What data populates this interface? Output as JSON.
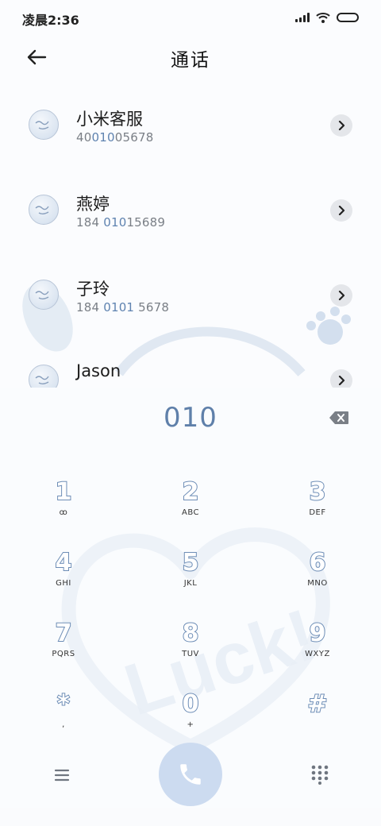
{
  "status_bar": {
    "time": "凌晨2:36"
  },
  "header": {
    "title": "通话"
  },
  "contacts": [
    {
      "name": "小米客服",
      "number_pre": "40",
      "number_hl": "010",
      "number_post": "05678"
    },
    {
      "name": "燕婷",
      "number_pre": "184 ",
      "number_hl": "010",
      "number_post": "15689"
    },
    {
      "name": "子玲",
      "number_pre": "184 ",
      "number_hl": "0101",
      "number_post": " 5678"
    },
    {
      "name": "Jason",
      "number_pre": "",
      "number_hl": "",
      "number_post": ""
    }
  ],
  "dialer": {
    "input": "010",
    "keys": [
      {
        "digit": "1",
        "letters": "ꝏ"
      },
      {
        "digit": "2",
        "letters": "ABC"
      },
      {
        "digit": "3",
        "letters": "DEF"
      },
      {
        "digit": "4",
        "letters": "GHI"
      },
      {
        "digit": "5",
        "letters": "JKL"
      },
      {
        "digit": "6",
        "letters": "MNO"
      },
      {
        "digit": "7",
        "letters": "PQRS"
      },
      {
        "digit": "8",
        "letters": "TUV"
      },
      {
        "digit": "9",
        "letters": "WXYZ"
      },
      {
        "digit": "*",
        "letters": ","
      },
      {
        "digit": "0",
        "letters": "+"
      },
      {
        "digit": "#",
        "letters": ""
      }
    ]
  },
  "background_text": "Luck!",
  "icons": {
    "back": "arrow-left-icon",
    "detail": "chevron-right-icon",
    "backspace": "backspace-icon",
    "call": "phone-icon",
    "menu": "menu-icon",
    "dialpad": "dialpad-icon"
  },
  "colors": {
    "accent": "#5f80aa",
    "call_button": "#ccdbf0"
  }
}
